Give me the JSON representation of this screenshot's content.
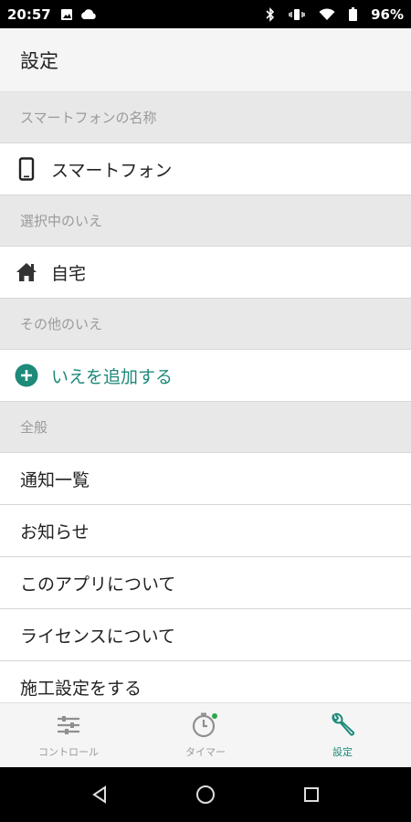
{
  "status_bar": {
    "time": "20:57",
    "battery": "96%"
  },
  "app_bar": {
    "title": "設定"
  },
  "sections": {
    "phone_name": {
      "header": "スマートフォンの名称",
      "value": "スマートフォン",
      "icon": "smartphone-icon"
    },
    "selected_home": {
      "header": "選択中のいえ",
      "value": "自宅",
      "icon": "home-icon"
    },
    "other_homes": {
      "header": "その他のいえ",
      "add_label": "いえを追加する",
      "icon": "add-circle-icon"
    },
    "general": {
      "header": "全般",
      "items": [
        "通知一覧",
        "お知らせ",
        "このアプリについて",
        "ライセンスについて",
        "施工設定をする"
      ]
    }
  },
  "bottom_nav": {
    "items": [
      {
        "label": "コントロール",
        "icon": "sliders-icon",
        "active": false
      },
      {
        "label": "タイマー",
        "icon": "timer-icon",
        "active": false
      },
      {
        "label": "設定",
        "icon": "wrench-icon",
        "active": true
      }
    ]
  },
  "colors": {
    "accent": "#1d8a7a",
    "section_bg": "#e8e8e8",
    "appbar_bg": "#f5f5f5"
  }
}
